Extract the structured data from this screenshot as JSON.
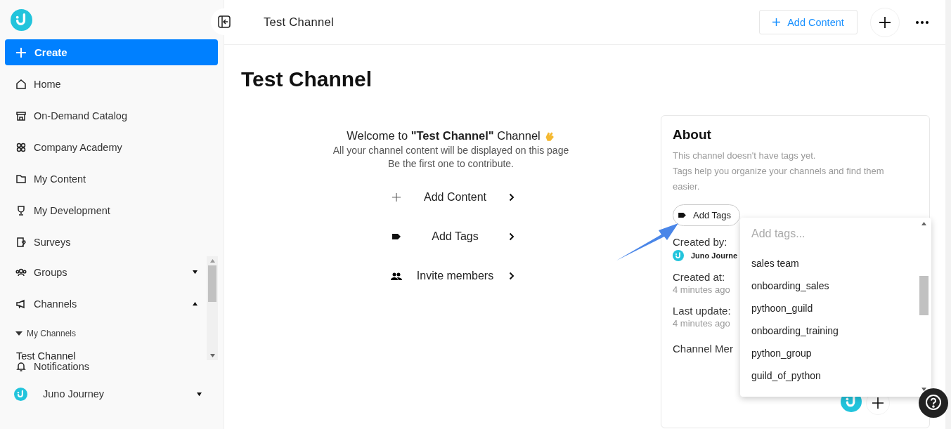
{
  "sidebar": {
    "create_label": "Create",
    "items": [
      {
        "label": "Home",
        "kind": "link"
      },
      {
        "label": "On-Demand Catalog",
        "kind": "link"
      },
      {
        "label": "Company Academy",
        "kind": "link"
      },
      {
        "label": "My Content",
        "kind": "link"
      },
      {
        "label": "My Development",
        "kind": "link"
      },
      {
        "label": "Surveys",
        "kind": "link"
      },
      {
        "label": "Groups",
        "kind": "group",
        "expanded": false
      },
      {
        "label": "Channels",
        "kind": "group",
        "expanded": true
      },
      {
        "label": "My Channels",
        "kind": "section",
        "expanded": true,
        "children": [
          {
            "label": "Test Channel"
          }
        ]
      }
    ],
    "notifications": "Notifications",
    "account": "Juno Journey"
  },
  "header": {
    "title": "Test Channel",
    "add_content": "Add Content"
  },
  "page": {
    "title": "Test Channel",
    "welcome": "Welcome to **\"Test Channel\"** Channel",
    "lines": [
      "All your channel content will be displayed on this page",
      "Be the first one to contribute."
    ],
    "actions": [
      {
        "label": "Add Content",
        "kind": "plus"
      },
      {
        "label": "Add Tags",
        "kind": "tag"
      },
      {
        "label": "Invite members",
        "kind": "people"
      }
    ]
  },
  "about": {
    "title": "About",
    "notes": [
      "This channel doesn't have tags yet.",
      "Tags help you organize your channels and find them easier."
    ],
    "add_tags": "Add Tags",
    "created_by_label": "Created by:",
    "created_by": "Juno Journe",
    "created_at_label": "Created at:",
    "created_at": "4 minutes ago",
    "updated_label": "Last update:",
    "updated": "4 minutes ago",
    "members_label": "Channel Mer"
  },
  "tag_dropdown": {
    "placeholder": "Add tags...",
    "options": [
      "sales team",
      "onboarding_sales",
      "pythoon_guild",
      "onboarding_training",
      "python_group",
      "guild_of_python"
    ]
  }
}
